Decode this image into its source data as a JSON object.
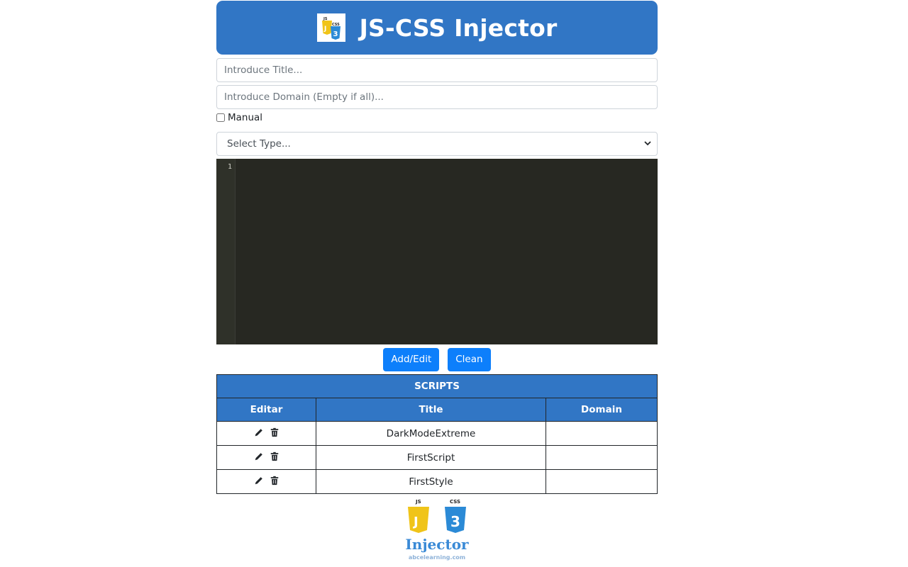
{
  "header": {
    "title": "JS-CSS Injector",
    "logo_icon": "js-css-logo-icon"
  },
  "form": {
    "title_placeholder": "Introduce Title...",
    "domain_placeholder": "Introduce Domain (Empty if all)...",
    "manual_label": "Manual",
    "manual_checked": false,
    "type_select": {
      "selected": "Select Type...",
      "icon": "chevron-down-icon"
    }
  },
  "editor": {
    "line_numbers": [
      "1"
    ],
    "content": ""
  },
  "actions": {
    "add_edit_label": "Add/Edit",
    "clean_label": "Clean"
  },
  "table": {
    "caption": "SCRIPTS",
    "columns": [
      "Editar",
      "Title",
      "Domain"
    ],
    "rows": [
      {
        "title": "DarkModeExtreme",
        "domain": ""
      },
      {
        "title": "FirstScript",
        "domain": ""
      },
      {
        "title": "FirstStyle",
        "domain": ""
      }
    ],
    "row_icons": [
      "pencil-icon",
      "trash-icon"
    ]
  },
  "footer": {
    "js_badge": "JS",
    "css_badge": "CSS",
    "brand": "Injector",
    "site": "abcelearning.com"
  },
  "colors": {
    "primary": "#3176c5",
    "button": "#0d7ffb",
    "editor_bg": "#272822",
    "js_yellow": "#f0c419",
    "css_blue": "#2b8ad6"
  }
}
